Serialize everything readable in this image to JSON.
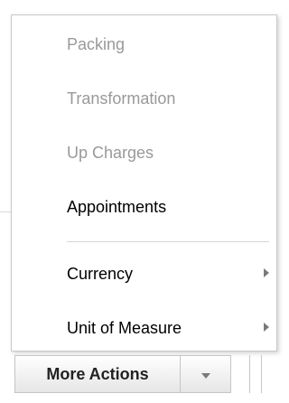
{
  "menu": {
    "items": [
      {
        "label": "Packing"
      },
      {
        "label": "Transformation"
      },
      {
        "label": "Up Charges"
      },
      {
        "label": "Appointments"
      },
      {
        "label": "Currency"
      },
      {
        "label": "Unit of Measure"
      }
    ]
  },
  "toolbar": {
    "more_actions_label": "More Actions"
  }
}
